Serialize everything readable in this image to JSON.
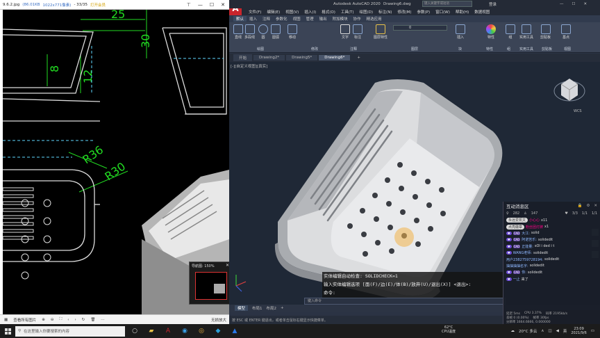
{
  "viewer": {
    "filename": "9.6.2.jpg",
    "filesize": "(86.01KB",
    "resolution": "1022x771像素)",
    "page": "- 33/35",
    "open_with": "打开会员",
    "bottom_left": "查看所有图片",
    "bottom_right": "无损放大",
    "zoom_popup_title": "导航图: 150%",
    "dims": {
      "d25": "25",
      "d30": "30",
      "d8": "8",
      "d12": "12",
      "dr36": "R36",
      "dr30": "R30"
    }
  },
  "acad": {
    "title": "Autodesk AutoCAD 2020",
    "doc_name": "Drawing6.dwg",
    "search_placeholder": "键入关键字或短语",
    "login": "登录",
    "menus": [
      "文件(F)",
      "编辑(E)",
      "视图(V)",
      "插入(I)",
      "格式(O)",
      "工具(T)",
      "绘图(D)",
      "标注(N)",
      "修改(M)",
      "参数(P)",
      "窗口(W)",
      "帮助(H)",
      "数据视图"
    ],
    "ribbon_tabs": [
      "默认",
      "插入",
      "注释",
      "参数化",
      "视图",
      "管理",
      "输出",
      "附加模块",
      "协作",
      "精选应用"
    ],
    "ribbon_buttons": [
      "直线",
      "多段线",
      "圆",
      "圆弧",
      "移动",
      "文字",
      "标注",
      "图层特性",
      "插入",
      "特性",
      "组",
      "实用工具",
      "剪贴板",
      "基点"
    ],
    "ribbon_panels": [
      "绘图",
      "修改",
      "注释",
      "图层",
      "块",
      "特性",
      "组",
      "实用工具",
      "剪贴板",
      "视图"
    ],
    "layer_value": "0",
    "doc_tabs": [
      "开始",
      "Drawing2*",
      "Drawing5*",
      "Drawing6*"
    ],
    "active_doc_tab": "Drawing6*",
    "viewport_label": "[-][自定义视图][真实]",
    "viewcube_label": "WCS",
    "command_lines": [
      "实体编辑自动检查:  SOLIDCHECK=1",
      "输入实体编辑选项 [面(F)/边(E)/体(B)/放弃(U)/退出(X)] <退出>:",
      "命令:"
    ],
    "command_prompt": "键入命令",
    "layout_tabs": [
      "模型",
      "布局1",
      "布局2"
    ],
    "status_text": "按 ESC 或 ENTER 键退出，或者单击鼠标右键显示快捷菜单。"
  },
  "chat": {
    "title": "互动消息区",
    "stats": {
      "viewers": "282",
      "fans": "147",
      "gift_count": "3/3",
      "a": "1/1",
      "b": "1/1"
    },
    "messages": [
      {
        "user": "",
        "text": "永远爱凯文",
        "extra": "小心心",
        "suffix": "x11"
      },
      {
        "user": "",
        "text": "点亮徽章",
        "extra": "粉丝团灯牌",
        "suffix": "x1"
      },
      {
        "user": "大江:",
        "text": "solid"
      },
      {
        "user": "阿诺苦乐:",
        "text": "solidedit"
      },
      {
        "user": "正能量:",
        "text": "sOl i ded i t"
      },
      {
        "user": "WANG老师:",
        "text": "solidedit"
      },
      {
        "user": "用户2382759728194:",
        "text": "solidedit"
      },
      {
        "user": "抽抽抽抽名字:",
        "text": "solidedit"
      },
      {
        "user": "你:",
        "text": "solidedit"
      },
      {
        "user": "一止",
        "text": "来了"
      }
    ],
    "footer_left": "延迟 5ms",
    "footer_cpu": "CPU 3.37%",
    "footer_net": "码率 2195kb/s",
    "footer_frames": "丢帧 0 (0.00%)",
    "footer_fps": "帧率 30fps",
    "footer_res": "分辨率 1664.6666, 0.000000"
  },
  "taskbar": {
    "search_placeholder": "在这里输入你要搜索的内容",
    "temp": "62°C",
    "temp_label": "CPU温度",
    "weather": "20°C 多云",
    "time": "23:09",
    "date": "2021/9/6"
  }
}
